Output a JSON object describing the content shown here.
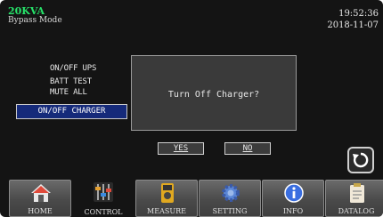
{
  "header": {
    "model": "20KVA",
    "mode": "Bypass Mode",
    "time": "19:52:36",
    "date": "2018-11-07"
  },
  "menu": {
    "items": [
      "ON/OFF UPS",
      "BATT TEST",
      "MUTE ALL"
    ],
    "selected": "ON/OFF CHARGER"
  },
  "dialog": {
    "message": "Turn Off Charger?",
    "yes_label": "YES",
    "no_label": "NO"
  },
  "nav": {
    "tabs": [
      {
        "label": "HOME",
        "icon": "home-icon"
      },
      {
        "label": "CONTROL",
        "icon": "control-sliders-icon"
      },
      {
        "label": "MEASURE",
        "icon": "meter-icon"
      },
      {
        "label": "SETTING",
        "icon": "gear-icon"
      },
      {
        "label": "INFO",
        "icon": "info-icon"
      },
      {
        "label": "DATALOG",
        "icon": "clipboard-icon"
      }
    ],
    "active": "CONTROL"
  },
  "colors": {
    "model_text": "#27e36a",
    "selected_bg": "#152a7a",
    "screen_bg": "#141414"
  }
}
